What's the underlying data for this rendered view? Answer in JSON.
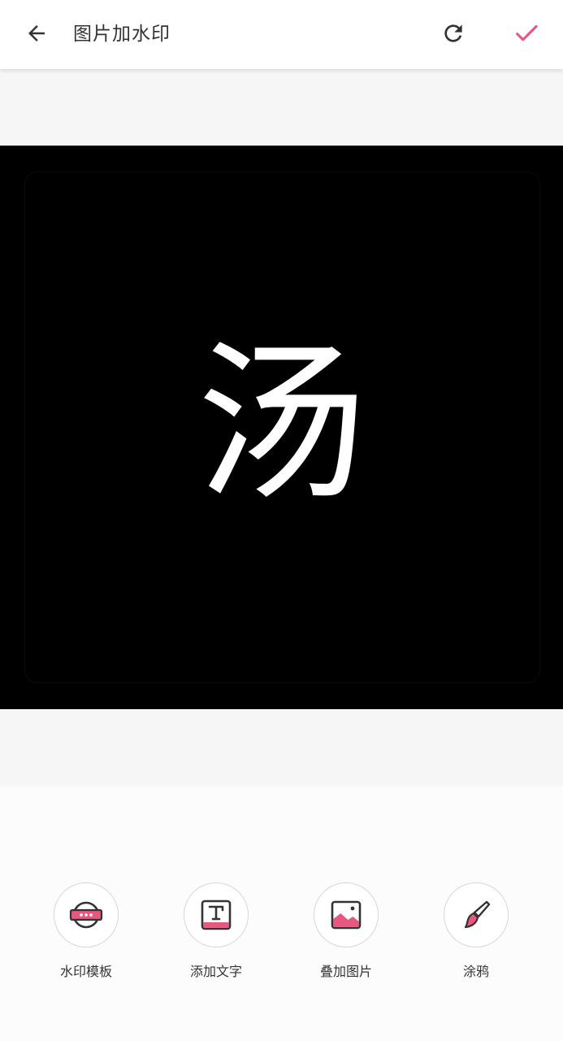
{
  "header": {
    "title": "图片加水印",
    "back_icon": "arrow-left-icon",
    "refresh_icon": "refresh-icon",
    "confirm_icon": "check-icon"
  },
  "photo": {
    "character": "汤"
  },
  "tools": [
    {
      "label": "水印模板",
      "icon": "watermark-template-icon"
    },
    {
      "label": "添加文字",
      "icon": "add-text-icon"
    },
    {
      "label": "叠加图片",
      "icon": "overlay-image-icon"
    },
    {
      "label": "涂鸦",
      "icon": "brush-icon"
    }
  ],
  "colors": {
    "accent": "#e8577f",
    "icon_dark": "#333333"
  }
}
